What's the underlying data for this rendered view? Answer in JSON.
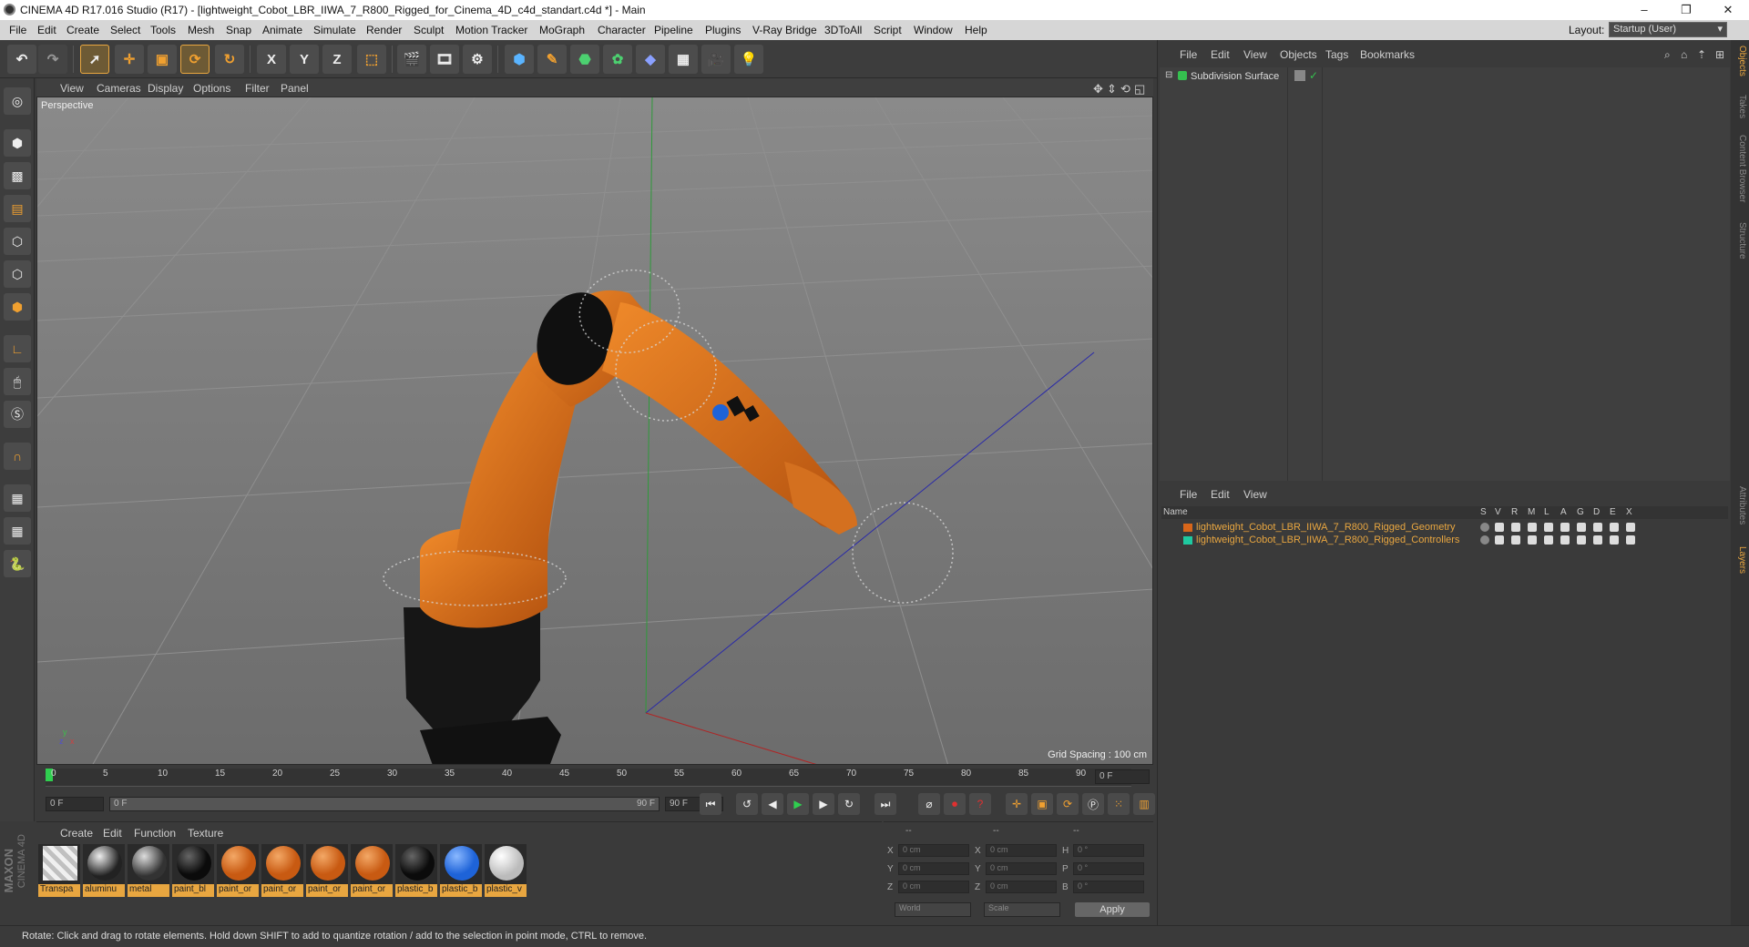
{
  "window": {
    "title": "CINEMA 4D R17.016 Studio (R17) - [lightweight_Cobot_LBR_IIWA_7_R800_Rigged_for_Cinema_4D_c4d_standart.c4d *] - Main",
    "minimize": "–",
    "maximize": "❐",
    "close": "✕"
  },
  "menu": {
    "items": [
      "File",
      "Edit",
      "Create",
      "Select",
      "Tools",
      "Mesh",
      "Snap",
      "Animate",
      "Simulate",
      "Render",
      "Sculpt",
      "Motion Tracker",
      "MoGraph",
      "Character",
      "Pipeline",
      "Plugins",
      "V-Ray Bridge",
      "3DToAll",
      "Script",
      "Window",
      "Help"
    ],
    "layout_label": "Layout:",
    "layout_value": "Startup (User)"
  },
  "toolbar": {
    "x_label": "X",
    "y_label": "Y",
    "z_label": "Z"
  },
  "viewport": {
    "menu": [
      "View",
      "Cameras",
      "Display",
      "Options",
      "Filter",
      "Panel"
    ],
    "label": "Perspective",
    "grid_spacing": "Grid Spacing : 100 cm",
    "axis_y": "y",
    "axis_x": "x",
    "axis_z": "z"
  },
  "timeline": {
    "ticks": [
      "0",
      "5",
      "10",
      "15",
      "20",
      "25",
      "30",
      "35",
      "40",
      "45",
      "50",
      "55",
      "60",
      "65",
      "70",
      "75",
      "80",
      "85",
      "90"
    ],
    "current_frame": "0 F",
    "start_field": "0 F",
    "range_left": "0 F",
    "range_right": "90 F",
    "end_field": "90 F"
  },
  "materials": {
    "menu": [
      "Create",
      "Edit",
      "Function",
      "Texture"
    ],
    "items": [
      {
        "label": "Transpa",
        "color": "#e8e8e8"
      },
      {
        "label": "aluminu",
        "color": "#222222"
      },
      {
        "label": "metal",
        "color": "#333333"
      },
      {
        "label": "paint_bl",
        "color": "#0b0b0b"
      },
      {
        "label": "paint_or",
        "color": "#c85a12"
      },
      {
        "label": "paint_or",
        "color": "#c85a12"
      },
      {
        "label": "paint_or",
        "color": "#c85a12"
      },
      {
        "label": "paint_or",
        "color": "#c85a12"
      },
      {
        "label": "plastic_b",
        "color": "#0b0b0b"
      },
      {
        "label": "plastic_b",
        "color": "#1e63d8"
      },
      {
        "label": "plastic_v",
        "color": "#e6e6e6"
      }
    ]
  },
  "coords": {
    "dashes": [
      "--",
      "--",
      "--"
    ],
    "rows": [
      {
        "a": "X",
        "av": "0 cm",
        "b": "X",
        "bv": "0 cm",
        "c": "H",
        "cv": "0 °"
      },
      {
        "a": "Y",
        "av": "0 cm",
        "b": "Y",
        "bv": "0 cm",
        "c": "P",
        "cv": "0 °"
      },
      {
        "a": "Z",
        "av": "0 cm",
        "b": "Z",
        "bv": "0 cm",
        "c": "B",
        "cv": "0 °"
      }
    ],
    "world": "World",
    "scale": "Scale",
    "apply": "Apply"
  },
  "objects": {
    "menu": [
      "File",
      "Edit",
      "View",
      "Objects",
      "Tags",
      "Bookmarks"
    ],
    "item": "Subdivision Surface"
  },
  "layers": {
    "menu": [
      "File",
      "Edit",
      "View"
    ],
    "columns": [
      "Name",
      "S",
      "V",
      "R",
      "M",
      "L",
      "A",
      "G",
      "D",
      "E",
      "X"
    ],
    "rows": [
      {
        "name": "lightweight_Cobot_LBR_IIWA_7_R800_Rigged_Geometry",
        "color": "#d8661a"
      },
      {
        "name": "lightweight_Cobot_LBR_IIWA_7_R800_Rigged_Controllers",
        "color": "#1fc9a0"
      }
    ]
  },
  "right_tabs": [
    "Objects",
    "Takes",
    "Content Browser",
    "Structure",
    "Attributes",
    "Layers"
  ],
  "brand": {
    "line1": "MAXON",
    "line2": "CINEMA 4D"
  },
  "status": "Rotate: Click and drag to rotate elements. Hold down SHIFT to add to quantize rotation / add to the selection in point mode, CTRL to remove."
}
